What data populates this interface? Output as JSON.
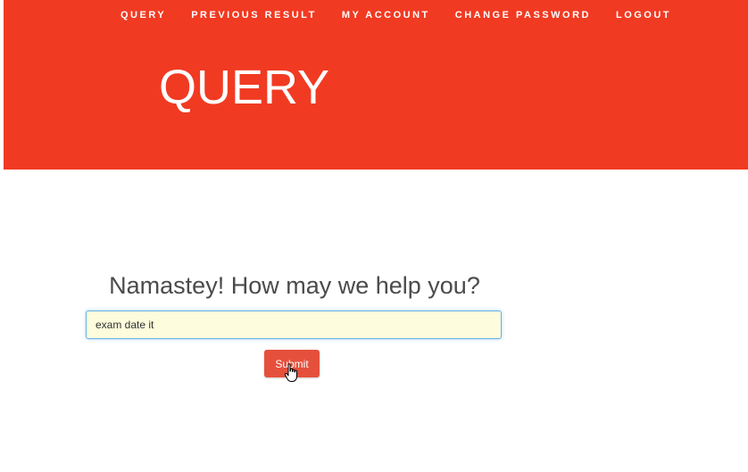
{
  "nav": {
    "items": [
      {
        "label": "QUERY"
      },
      {
        "label": "PREVIOUS RESULT"
      },
      {
        "label": "MY ACCOUNT"
      },
      {
        "label": "CHANGE PASSWORD"
      },
      {
        "label": "LOGOUT"
      }
    ]
  },
  "hero": {
    "title": "QUERY",
    "background_color": "#f13a22"
  },
  "main": {
    "greeting": "Namastey! How may we help you?",
    "query_input": {
      "value": "exam date it",
      "placeholder": ""
    },
    "submit_label": "Submit",
    "submit_color": "#e5503c",
    "cursor_icon": "hand-pointer-icon"
  }
}
